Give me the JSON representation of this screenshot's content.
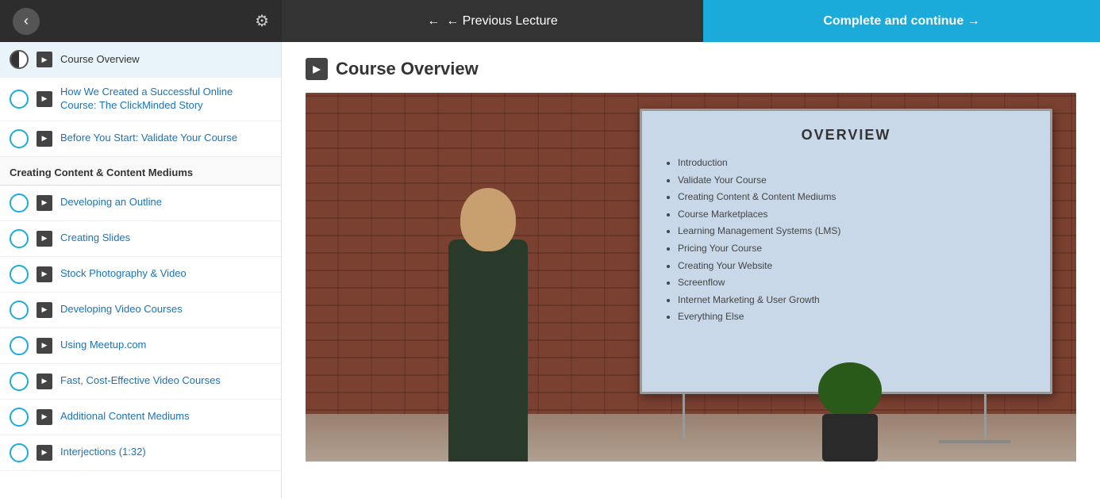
{
  "nav": {
    "back_label": "‹",
    "gear_label": "⚙",
    "prev_label": "← Previous Lecture",
    "complete_label": "Complete and continue →"
  },
  "sidebar": {
    "section1_items": [
      {
        "id": "course-overview",
        "text": "Course Overview",
        "active": true,
        "checked": "half"
      },
      {
        "id": "clickminded-story",
        "text": "How We Created a Successful Online Course: The ClickMinded Story",
        "active": false,
        "checked": "circle"
      },
      {
        "id": "validate-course",
        "text": "Before You Start: Validate Your Course",
        "active": false,
        "checked": "circle"
      }
    ],
    "section2_label": "Creating Content & Content Mediums",
    "section2_items": [
      {
        "id": "developing-outline",
        "text": "Developing an Outline",
        "checked": "circle"
      },
      {
        "id": "creating-slides",
        "text": "Creating Slides",
        "checked": "circle"
      },
      {
        "id": "stock-photo-video",
        "text": "Stock Photography & Video",
        "checked": "circle"
      },
      {
        "id": "developing-video",
        "text": "Developing Video Courses",
        "checked": "circle"
      },
      {
        "id": "using-meetup",
        "text": "Using Meetup.com",
        "checked": "circle"
      },
      {
        "id": "fast-cost-effective",
        "text": "Fast, Cost-Effective Video Courses",
        "checked": "circle"
      },
      {
        "id": "additional-content",
        "text": "Additional Content Mediums",
        "checked": "circle"
      },
      {
        "id": "interjections",
        "text": "Interjections (1:32)",
        "checked": "circle"
      }
    ]
  },
  "content": {
    "title": "Course Overview",
    "screen_title": "OVERVIEW",
    "screen_items": [
      "Introduction",
      "Validate Your Course",
      "Creating Content & Content Mediums",
      "Course Marketplaces",
      "Learning Management Systems (LMS)",
      "Pricing Your Course",
      "Creating Your Website",
      "Screenflow",
      "Internet Marketing & User Growth",
      "Everything Else"
    ]
  }
}
